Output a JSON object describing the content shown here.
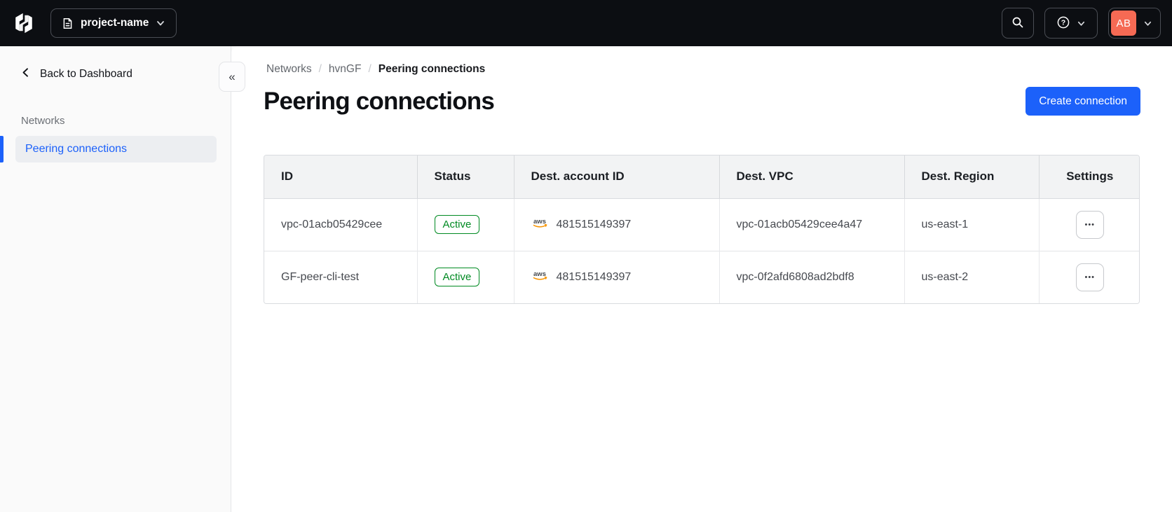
{
  "colors": {
    "topbar_bg": "#0c0e12",
    "accent_blue": "#1c61fa",
    "success_green": "#008a22",
    "avatar_orange": "#f56a54",
    "aws_orange": "#f79400",
    "sidebar_bg": "#fafafa",
    "table_header_bg": "#f2f3f4"
  },
  "topbar": {
    "project_switcher_label": "project-name",
    "avatar_initials": "AB"
  },
  "sidebar": {
    "back_label": "Back to Dashboard",
    "section_label": "Networks",
    "active_item": "Peering connections",
    "collapse_glyph": "«"
  },
  "breadcrumb": {
    "items": [
      "Networks",
      "hvnGF",
      "Peering connections"
    ],
    "separator": "/"
  },
  "page": {
    "title": "Peering connections",
    "create_button_label": "Create connection"
  },
  "table": {
    "columns": [
      "ID",
      "Status",
      "Dest. account ID",
      "Dest. VPC",
      "Dest. Region",
      "Settings"
    ],
    "aws_label": "aws",
    "settings_menu_glyph": "•••",
    "rows": [
      {
        "id": "vpc-01acb05429cee",
        "status": "Active",
        "dest_account_id": "481515149397",
        "dest_vpc": "vpc-01acb05429cee4a47",
        "dest_region": "us-east-1"
      },
      {
        "id": "GF-peer-cli-test",
        "status": "Active",
        "dest_account_id": "481515149397",
        "dest_vpc": "vpc-0f2afd6808ad2bdf8",
        "dest_region": "us-east-2"
      }
    ]
  }
}
